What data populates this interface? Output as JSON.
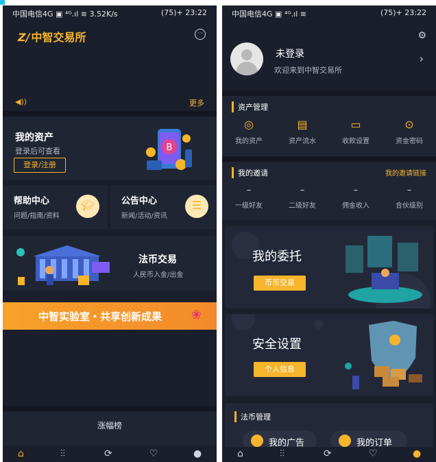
{
  "left": {
    "status": {
      "carrier": "中国电信4G ▣ ⁴ᴳ.ıl ≋ 3.52K/s",
      "time": "(75)+ 23:22"
    },
    "app": {
      "logo_mark": "Z/",
      "name": "中智交易所"
    },
    "notice": {
      "more": "更多"
    },
    "asset_card": {
      "title": "我的资产",
      "subtitle": "登录后可查看",
      "login": "登录/注册"
    },
    "help": {
      "title": "帮助中心",
      "subtitle": "问题/指南/资料"
    },
    "announce": {
      "title": "公告中心",
      "subtitle": "新闻/活动/资讯"
    },
    "fiat": {
      "title": "法币交易",
      "subtitle": "人民币入金/出金"
    },
    "banner": {
      "text": "中智实验室・共享创新成果"
    },
    "gains": {
      "label": "涨幅榜"
    }
  },
  "right": {
    "status": {
      "carrier": "中国电信4G ▣ ⁴ᴳ.ıl ≋",
      "time": "(75)+ 23:22"
    },
    "profile": {
      "name": "未登录",
      "subtitle": "欢迎来到中智交易所"
    },
    "asset_mgmt": {
      "title": "资产管理",
      "items": [
        {
          "label": "我的资产",
          "icon": "coin-icon"
        },
        {
          "label": "资产流水",
          "icon": "ledger-icon"
        },
        {
          "label": "收款设置",
          "icon": "card-icon"
        },
        {
          "label": "资金密码",
          "icon": "lock-icon"
        }
      ]
    },
    "invite": {
      "title": "我的邀请",
      "link": "我的邀请链接",
      "items": [
        {
          "value": "–",
          "label": "一级好友"
        },
        {
          "value": "–",
          "label": "二级好友"
        },
        {
          "value": "–",
          "label": "佣金收入"
        },
        {
          "value": "–",
          "label": "合伙级别"
        }
      ]
    },
    "entrust": {
      "title": "我的委托",
      "button": "币币交易"
    },
    "security": {
      "title": "安全设置",
      "button": "个人信息"
    },
    "fiat_mgmt": {
      "title": "法币管理",
      "ads": "我的广告",
      "orders": "我的订单"
    }
  },
  "colors": {
    "accent": "#f6b52b",
    "bg": "#1b1f2c",
    "card": "#202533"
  }
}
